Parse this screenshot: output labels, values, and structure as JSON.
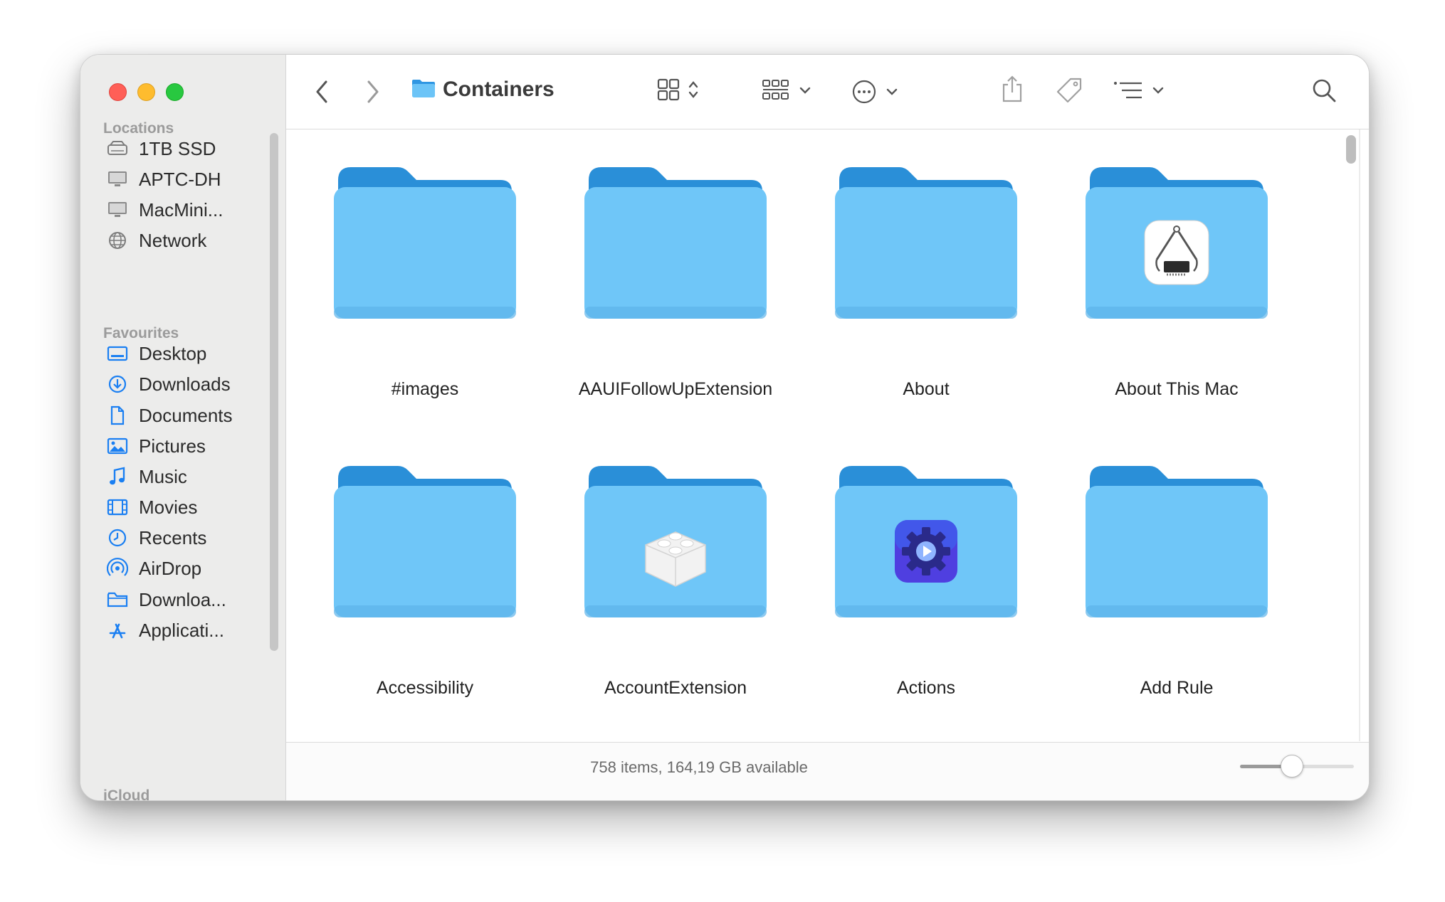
{
  "window": {
    "title": "Containers"
  },
  "sidebar": {
    "sections": {
      "locations": "Locations",
      "favourites": "Favourites",
      "icloud": "iCloud"
    },
    "locations": [
      {
        "label": "1TB SSD",
        "icon": "drive-icon"
      },
      {
        "label": "APTC-DH",
        "icon": "display-icon"
      },
      {
        "label": "MacMini...",
        "icon": "display-icon"
      },
      {
        "label": "Network",
        "icon": "network-globe-icon"
      }
    ],
    "favourites": [
      {
        "label": "Desktop",
        "icon": "desktop-icon"
      },
      {
        "label": "Downloads",
        "icon": "download-circle-icon"
      },
      {
        "label": "Documents",
        "icon": "document-icon"
      },
      {
        "label": "Pictures",
        "icon": "photo-icon"
      },
      {
        "label": "Music",
        "icon": "music-note-icon"
      },
      {
        "label": "Movies",
        "icon": "film-icon"
      },
      {
        "label": "Recents",
        "icon": "clock-icon"
      },
      {
        "label": "AirDrop",
        "icon": "airdrop-icon"
      },
      {
        "label": "Downloa...",
        "icon": "folder-outline-icon"
      },
      {
        "label": "Applicati...",
        "icon": "app-store-icon"
      }
    ]
  },
  "toolbar": {
    "title": "Containers",
    "icons": [
      "back-chevron-icon",
      "forward-chevron-icon",
      "folder-icon",
      "icon-view-icon",
      "group-icon",
      "more-actions-icon",
      "share-icon",
      "tag-icon",
      "sort-list-icon",
      "search-icon"
    ]
  },
  "items": [
    {
      "name": "#images",
      "badge": "none"
    },
    {
      "name": "AAUIFollowUpExtension",
      "badge": "none"
    },
    {
      "name": "About",
      "badge": "none"
    },
    {
      "name": "About This Mac",
      "badge": "system-information-icon"
    },
    {
      "name": "Accessibility",
      "badge": "none"
    },
    {
      "name": "AccountExtension",
      "badge": "extension-brick-icon"
    },
    {
      "name": "Actions",
      "badge": "automator-gear-icon"
    },
    {
      "name": "Add Rule",
      "badge": "none"
    }
  ],
  "status": {
    "text": "758 items, 164,19 GB available",
    "icon_size_slider": 0.45
  },
  "colors": {
    "folder_front": "#6fc6f8",
    "folder_back": "#2a8fd8",
    "accent": "#1a7ff2"
  }
}
